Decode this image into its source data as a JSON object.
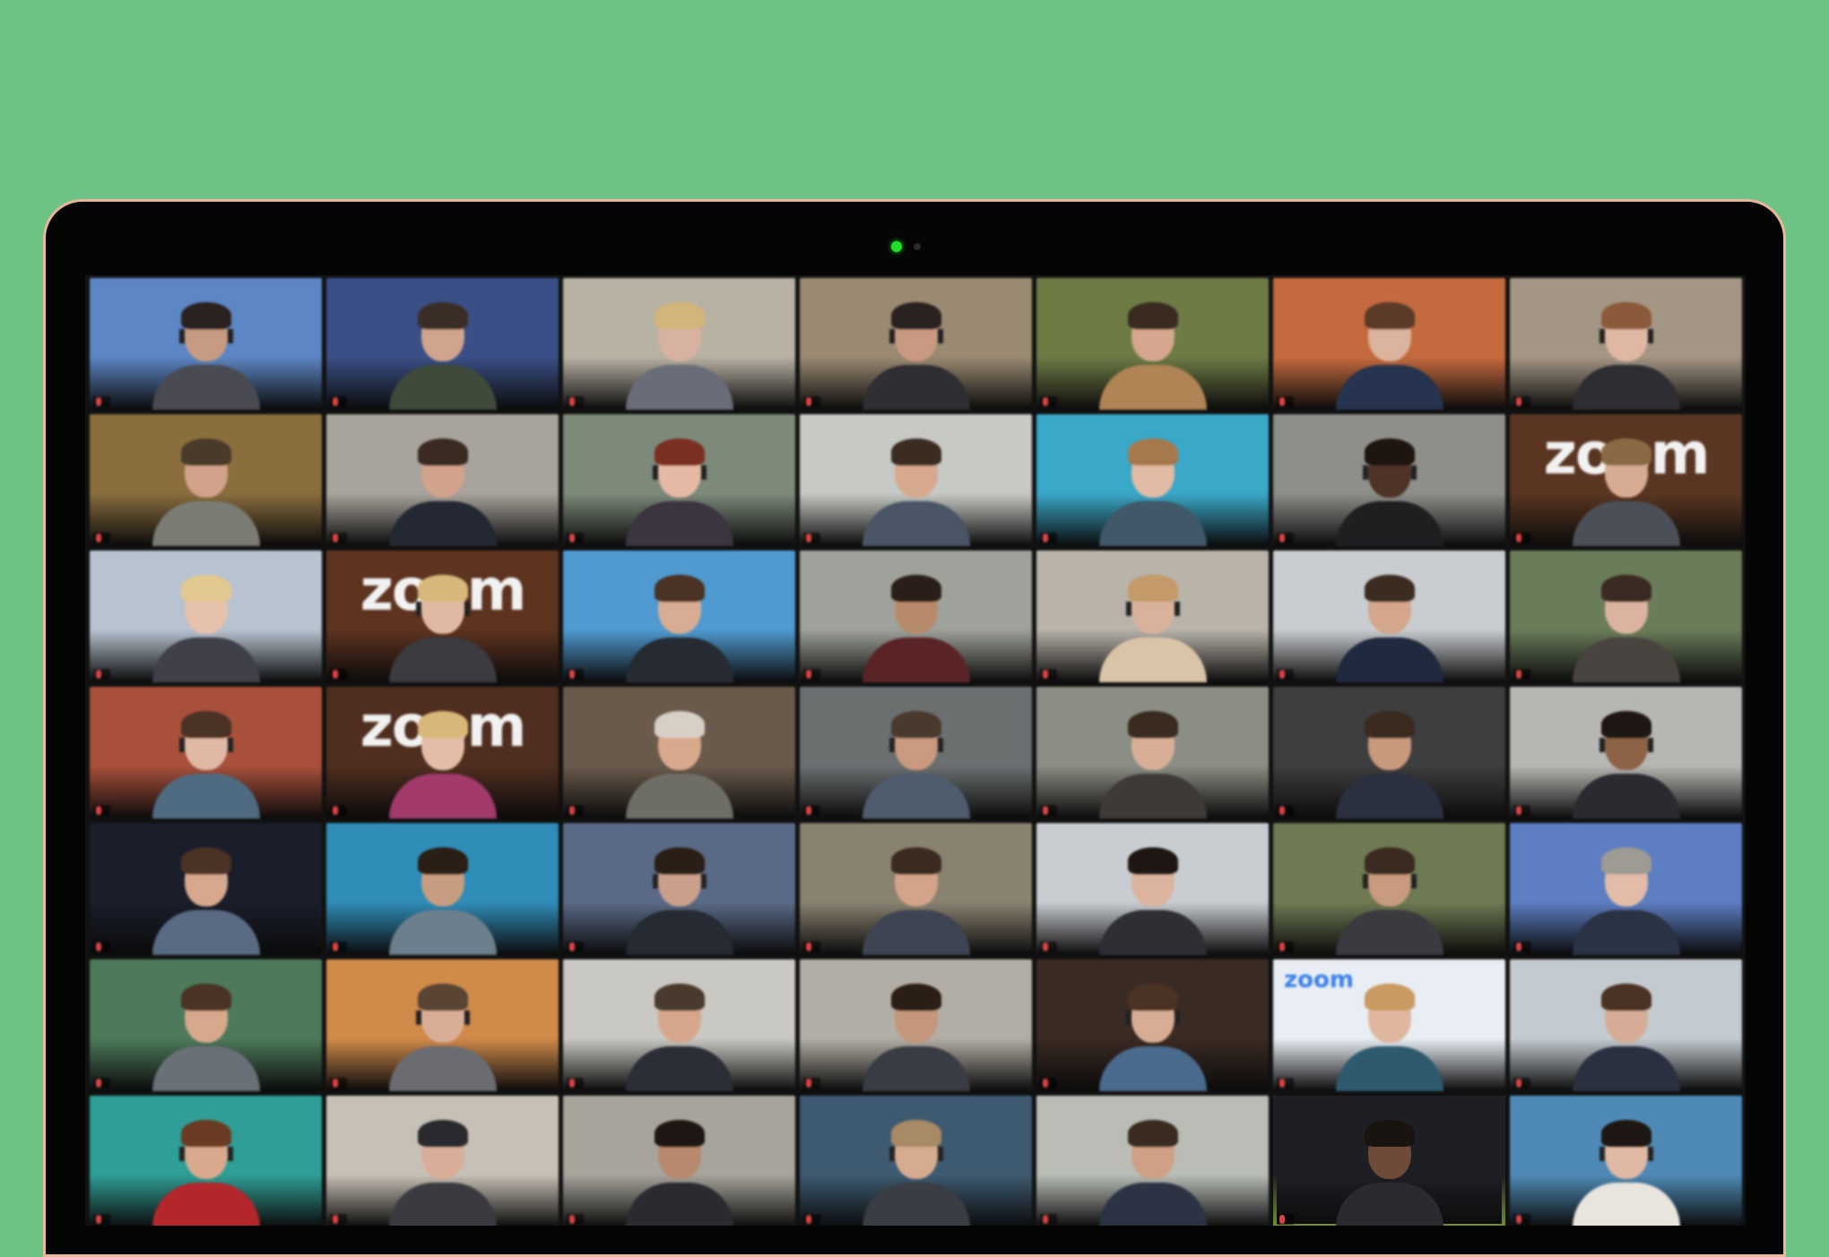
{
  "colors": {
    "background": "#6dc285",
    "laptop_bezel": "#050505",
    "laptop_rim": "#e9b898",
    "camera_led": "#1fe02a",
    "active_speaker_border": "#b5e04b"
  },
  "meeting": {
    "layout": "gallery-view",
    "rows": 7,
    "columns": 7,
    "participants": [
      {
        "name": "",
        "bg": "#5d86c4",
        "skin": "#c79b82",
        "hair": "#2a2220",
        "shirt": "#4a4a52",
        "logo": ""
      },
      {
        "name": "",
        "bg": "#3a4f86",
        "skin": "#d1a48d",
        "hair": "#3a2d25",
        "shirt": "#3f4a3a",
        "logo": ""
      },
      {
        "name": "",
        "bg": "#b8b2a4",
        "skin": "#d8b2a0",
        "hair": "#d2b57a",
        "shirt": "#6b6c7a",
        "logo": ""
      },
      {
        "name": "",
        "bg": "#9a8a72",
        "skin": "#c99a82",
        "hair": "#2a2220",
        "shirt": "#2e2e33",
        "logo": ""
      },
      {
        "name": "",
        "bg": "#6e7b45",
        "skin": "#d4a78e",
        "hair": "#3a2a1f",
        "shirt": "#b08454",
        "logo": ""
      },
      {
        "name": "",
        "bg": "#c46a3e",
        "skin": "#dcb39c",
        "hair": "#5b3b28",
        "shirt": "#26344f",
        "logo": ""
      },
      {
        "name": "",
        "bg": "#a49684",
        "skin": "#e0b7a2",
        "hair": "#8a5a3a",
        "shirt": "#2d2d33",
        "logo": ""
      },
      {
        "name": "",
        "bg": "#8a6e3e",
        "skin": "#d2a28a",
        "hair": "#4a3a2a",
        "shirt": "#7b7c74",
        "logo": ""
      },
      {
        "name": "",
        "bg": "#a8a39c",
        "skin": "#d2a38c",
        "hair": "#3a2a22",
        "shirt": "#232833",
        "logo": ""
      },
      {
        "name": "",
        "bg": "#7d8a7a",
        "skin": "#e5b9a4",
        "hair": "#7b2f22",
        "shirt": "#3a3540",
        "logo": ""
      },
      {
        "name": "",
        "bg": "#c7c9c4",
        "skin": "#d6a88e",
        "hair": "#3b2c22",
        "shirt": "#4a5666",
        "logo": ""
      },
      {
        "name": "",
        "bg": "#3aa8c8",
        "skin": "#e2bba4",
        "hair": "#a6784e",
        "shirt": "#405868",
        "logo": ""
      },
      {
        "name": "",
        "bg": "#8e8e8a",
        "skin": "#4e3327",
        "hair": "#1e1410",
        "shirt": "#1f1f22",
        "logo": ""
      },
      {
        "name": "",
        "bg": "#5a3622",
        "skin": "#d8ac92",
        "hair": "#8a6a45",
        "shirt": "#4b5058",
        "logo": "zoom"
      },
      {
        "name": "",
        "bg": "#b7c3d0",
        "skin": "#e6c1ac",
        "hair": "#e2c890",
        "shirt": "#40404a",
        "logo": ""
      },
      {
        "name": "",
        "bg": "#5e3320",
        "skin": "#e1b9a3",
        "hair": "#d8b77a",
        "shirt": "#3b3b40",
        "logo": "zoom"
      },
      {
        "name": "",
        "bg": "#4f9ad0",
        "skin": "#d9ac94",
        "hair": "#4a3224",
        "shirt": "#262b33",
        "logo": ""
      },
      {
        "name": "",
        "bg": "#9ea29a",
        "skin": "#b88a6c",
        "hair": "#2a1f18",
        "shirt": "#5a2427",
        "logo": ""
      },
      {
        "name": "",
        "bg": "#b9b3aa",
        "skin": "#d9b29c",
        "hair": "#c49a6a",
        "shirt": "#d9c4a8",
        "logo": ""
      },
      {
        "name": "",
        "bg": "#c9ccd0",
        "skin": "#d4a68c",
        "hair": "#3b2c22",
        "shirt": "#1f2a3e",
        "logo": ""
      },
      {
        "name": "",
        "bg": "#6b7c5a",
        "skin": "#dcb3a0",
        "hair": "#3a2a22",
        "shirt": "#4a4440",
        "logo": ""
      },
      {
        "name": "",
        "bg": "#a8503a",
        "skin": "#e0b9a4",
        "hair": "#4a3224",
        "shirt": "#4e6b82",
        "logo": ""
      },
      {
        "name": "",
        "bg": "#4f2e1f",
        "skin": "#e3bda8",
        "hair": "#d8b77a",
        "shirt": "#a23a6c",
        "logo": "zoom"
      },
      {
        "name": "",
        "bg": "#6a5a4c",
        "skin": "#d9a98e",
        "hair": "#d8d0c6",
        "shirt": "#6e6e66",
        "logo": ""
      },
      {
        "name": "",
        "bg": "#6b6f70",
        "skin": "#c99a80",
        "hair": "#4a3a2e",
        "shirt": "#4e5c6e",
        "logo": ""
      },
      {
        "name": "",
        "bg": "#8a8e84",
        "skin": "#d8ae96",
        "hair": "#3a2a20",
        "shirt": "#3f3a38",
        "logo": ""
      },
      {
        "name": "",
        "bg": "#3e3e40",
        "skin": "#c9997c",
        "hair": "#3a2a20",
        "shirt": "#2b3040",
        "logo": ""
      },
      {
        "name": "",
        "bg": "#b6b6b2",
        "skin": "#8d6247",
        "hair": "#1e1612",
        "shirt": "#2a2a30",
        "logo": ""
      },
      {
        "name": "",
        "bg": "#1a1e2a",
        "skin": "#d6a98e",
        "hair": "#4a3224",
        "shirt": "#5a6a82",
        "logo": ""
      },
      {
        "name": "",
        "bg": "#2f8db8",
        "skin": "#c79c80",
        "hair": "#2a1e16",
        "shirt": "#6d7f8c",
        "logo": ""
      },
      {
        "name": "",
        "bg": "#5a6a86",
        "skin": "#caa08a",
        "hair": "#2a1e16",
        "shirt": "#252a33",
        "logo": ""
      },
      {
        "name": "",
        "bg": "#8a8270",
        "skin": "#d3a48a",
        "hair": "#3a2a20",
        "shirt": "#3e4452",
        "logo": ""
      },
      {
        "name": "",
        "bg": "#c9cdd2",
        "skin": "#dcb49e",
        "hair": "#1e1612",
        "shirt": "#2e2e35",
        "logo": ""
      },
      {
        "name": "",
        "bg": "#6e7a52",
        "skin": "#c89a7e",
        "hair": "#3a2a20",
        "shirt": "#3a3a40",
        "logo": ""
      },
      {
        "name": "",
        "bg": "#5d7ec2",
        "skin": "#e2bca8",
        "hair": "#9e9a94",
        "shirt": "#2a3344",
        "logo": ""
      },
      {
        "name": "",
        "bg": "#4d7a5a",
        "skin": "#d6a88c",
        "hair": "#4a3224",
        "shirt": "#6a7078",
        "logo": ""
      },
      {
        "name": "",
        "bg": "#d08a4a",
        "skin": "#d9ae96",
        "hair": "#5a4434",
        "shirt": "#6a6c72",
        "logo": ""
      },
      {
        "name": "",
        "bg": "#c9c8c2",
        "skin": "#d6a68c",
        "hair": "#4a3a2e",
        "shirt": "#2b2e36",
        "logo": ""
      },
      {
        "name": "",
        "bg": "#b3aea5",
        "skin": "#c4967a",
        "hair": "#2a1e16",
        "shirt": "#3a3c44",
        "logo": ""
      },
      {
        "name": "",
        "bg": "#3a2a24",
        "skin": "#d9ad94",
        "hair": "#4a3224",
        "shirt": "#4a6a8e",
        "logo": ""
      },
      {
        "name": "",
        "bg": "#e8eef4",
        "skin": "#e0b69e",
        "hair": "#c99a62",
        "shirt": "#2e5a6e",
        "logo": "zoom-small"
      },
      {
        "name": "",
        "bg": "#c4cbd0",
        "skin": "#d6ac96",
        "hair": "#4a3224",
        "shirt": "#2b3040",
        "logo": ""
      },
      {
        "name": "",
        "bg": "#2f9e96",
        "skin": "#d9a98e",
        "hair": "#6a3a22",
        "shirt": "#b3262c",
        "logo": ""
      },
      {
        "name": "",
        "bg": "#c7c0b6",
        "skin": "#d8ae98",
        "hair": "#2a2a2e",
        "shirt": "#3a3a40",
        "logo": ""
      },
      {
        "name": "",
        "bg": "#a7a49c",
        "skin": "#b8896c",
        "hair": "#1e1612",
        "shirt": "#2a2a30",
        "logo": ""
      },
      {
        "name": "",
        "bg": "#3e5a70",
        "skin": "#d7ab90",
        "hair": "#a88a64",
        "shirt": "#3a3e44",
        "logo": ""
      },
      {
        "name": "",
        "bg": "#b9bdb6",
        "skin": "#cf9f86",
        "hair": "#3a2a20",
        "shirt": "#2b3344",
        "logo": ""
      },
      {
        "name": "",
        "bg": "#1e1e24",
        "skin": "#6e4a38",
        "hair": "#1a1410",
        "shirt": "#2a2a30",
        "logo": "",
        "active": true
      },
      {
        "name": "",
        "bg": "#4f8ab6",
        "skin": "#e1b8a4",
        "hair": "#1e1612",
        "shirt": "#e8e4de",
        "logo": ""
      }
    ]
  }
}
